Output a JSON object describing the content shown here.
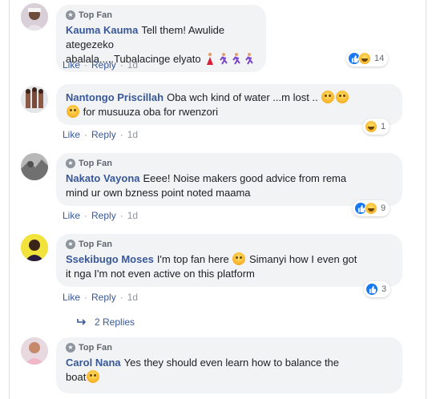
{
  "badge_label": "Top Fan",
  "actions": {
    "like": "Like",
    "reply": "Reply",
    "sep": "·"
  },
  "comments": [
    {
      "name": "Kauma Kauma",
      "text_line1": "Tell them! Awulide ategezeko",
      "text_line2": "abalala.....Tubalacinge elyato",
      "time": "1d",
      "reaction_count": "14",
      "reactions": [
        "like",
        "haha"
      ]
    },
    {
      "name": "Nantongo Priscillah",
      "text_line1": "Oba wch kind of water ...m lost ..",
      "text_line2": "for musuuza oba for rwenzori",
      "time": "1d",
      "reaction_count": "1",
      "reactions": [
        "haha"
      ]
    },
    {
      "name": "Nakato Vayona",
      "text_line1": "Eeee! Noise makers good advice from rema",
      "text_line2": "mind ur own bzness point noted maama",
      "time": "1d",
      "reaction_count": "9",
      "reactions": [
        "like",
        "haha"
      ]
    },
    {
      "name": "Ssekibugo Moses",
      "text_line1": "I'm top fan here",
      "text_line1b": "Simanyi how I even got",
      "text_line2": "it nga I'm not even active on this platform",
      "time": "1d",
      "reaction_count": "3",
      "reactions": [
        "like"
      ],
      "replies_label": "2 Replies"
    },
    {
      "name": "Carol Nana",
      "text_line1": "Yes they should even learn how to balance the",
      "text_line2": "boat"
    }
  ],
  "colors": {
    "name_link": "#385898",
    "bubble_bg": "#f2f3f5",
    "like_blue": "#1877f2"
  }
}
